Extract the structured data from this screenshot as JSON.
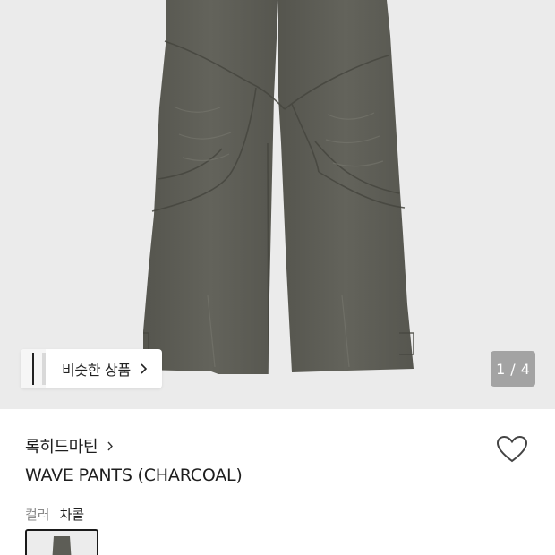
{
  "gallery": {
    "similar_products_label": "비슷한 상품",
    "pager": {
      "current": "1",
      "separator": "/",
      "total": "4"
    }
  },
  "product": {
    "brand": "록히드마틴",
    "name": "WAVE PANTS (CHARCOAL)"
  },
  "options": {
    "color_label": "컬러",
    "color_value": "차콜"
  },
  "colors": {
    "gallery_bg": "#ebebeb",
    "pants": "#5f5f57"
  }
}
